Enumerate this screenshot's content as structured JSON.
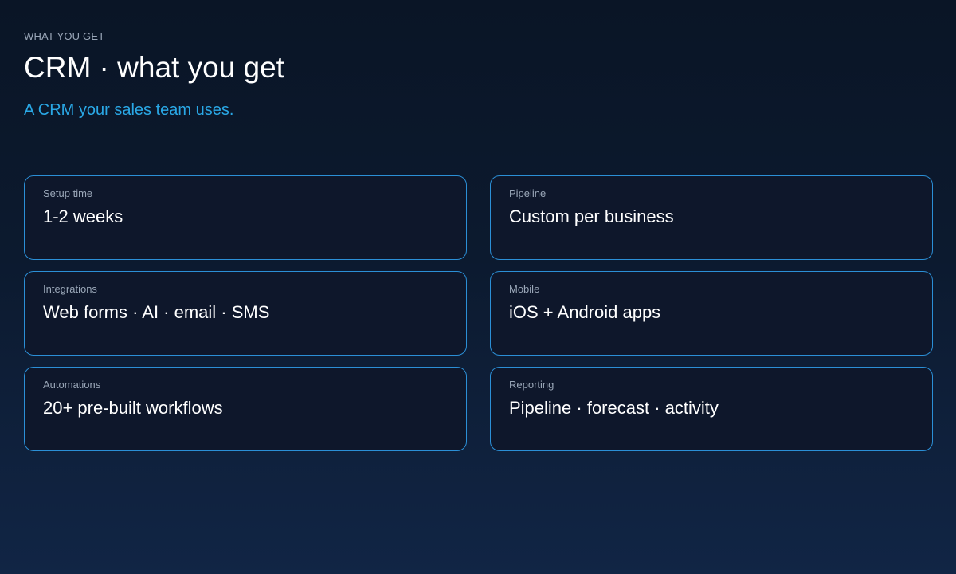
{
  "header": {
    "eyebrow": "WHAT YOU GET",
    "title": "CRM · what you get",
    "subtitle": "A CRM your sales team uses."
  },
  "cards": [
    {
      "label": "Setup time",
      "value": "1-2 weeks"
    },
    {
      "label": "Pipeline",
      "value": "Custom per business"
    },
    {
      "label": "Integrations",
      "value": "Web forms · AI · email · SMS"
    },
    {
      "label": "Mobile",
      "value": "iOS + Android apps"
    },
    {
      "label": "Automations",
      "value": "20+ pre-built workflows"
    },
    {
      "label": "Reporting",
      "value": "Pipeline · forecast · activity"
    }
  ],
  "colors": {
    "accent": "#2aa8e6",
    "card_border": "#2b8fd6",
    "card_background": "#0e172b",
    "muted_text": "#9aa7b8",
    "background_top": "#0a1526",
    "background_bottom": "#112545"
  }
}
